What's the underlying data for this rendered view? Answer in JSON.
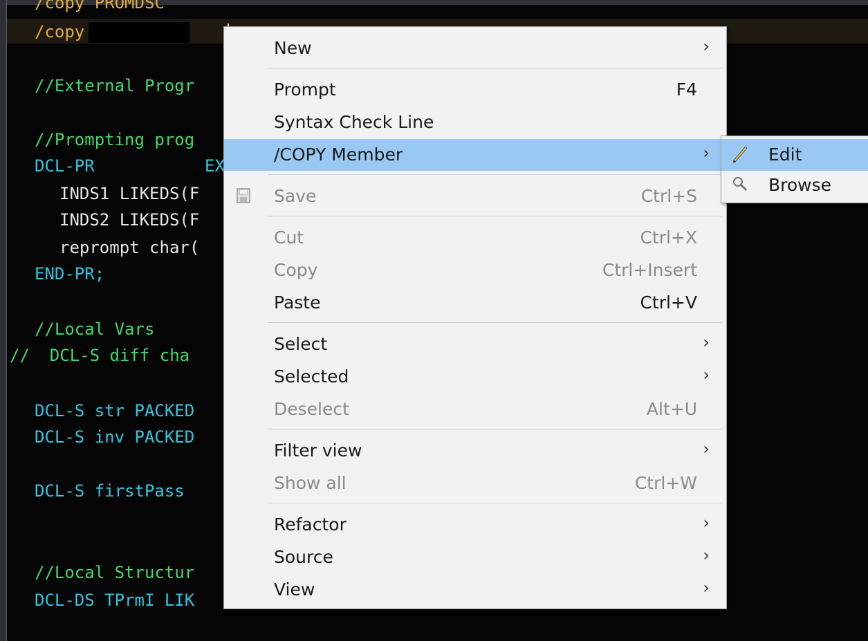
{
  "editor": {
    "lines": [
      "/copy PROMDSC",
      "/copy",
      "//External Progr",
      "//Prompting prog",
      "DCL-PR",
      "EX",
      "INDS1 LIKEDS(F",
      "INDS2 LIKEDS(F",
      "reprompt char(",
      "END-PR;",
      "//Local Vars",
      "//  DCL-S diff cha",
      "DCL-S str PACKED",
      "DCL-S inv PACKED",
      "DCL-S firstPass",
      "//Local Structur",
      "DCL-DS TPrmI LIK"
    ]
  },
  "context_menu": {
    "new": "New",
    "prompt": "Prompt",
    "prompt_sc": "F4",
    "syntax_check": "Syntax Check Line",
    "copy_member": "/COPY Member",
    "save": "Save",
    "save_sc": "Ctrl+S",
    "cut": "Cut",
    "cut_sc": "Ctrl+X",
    "copy": "Copy",
    "copy_sc": "Ctrl+Insert",
    "paste": "Paste",
    "paste_sc": "Ctrl+V",
    "select": "Select",
    "selected": "Selected",
    "deselect": "Deselect",
    "deselect_sc": "Alt+U",
    "filter_view": "Filter view",
    "show_all": "Show all",
    "show_all_sc": "Ctrl+W",
    "refactor": "Refactor",
    "source": "Source",
    "view": "View",
    "arrow": "›"
  },
  "submenu": {
    "edit": "Edit",
    "browse": "Browse"
  },
  "colors": {
    "highlight": "#99c9f3",
    "menu_bg": "#f2f2f2",
    "keyword": "#2fc7e0",
    "comment": "#3fd96a",
    "directive": "#e8a83b"
  }
}
